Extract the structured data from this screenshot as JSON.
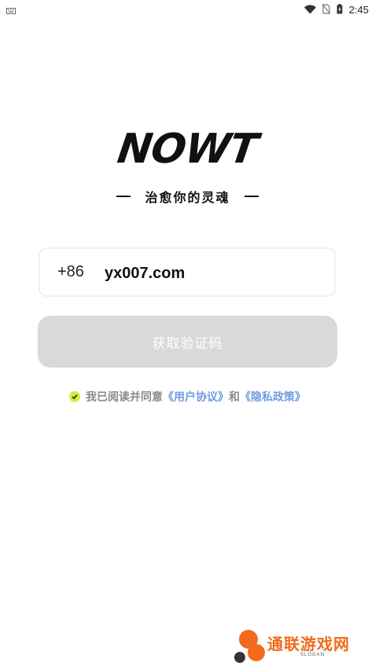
{
  "status_bar": {
    "time": "2:45",
    "icons": [
      "keyboard-icon",
      "wifi-icon",
      "no-sim-icon",
      "battery-charging-icon"
    ]
  },
  "logo": {
    "text": "NOWT",
    "slogan": "治愈你的灵魂"
  },
  "login": {
    "country_code": "+86",
    "phone_value": "yx007.com",
    "get_code_label": "获取验证码"
  },
  "agreement": {
    "checked": true,
    "prefix": "我已阅读并同意",
    "user_agreement": "《用户协议》",
    "connector": "和",
    "privacy_policy": "《隐私政策》"
  },
  "watermark": {
    "title": "通联游戏网",
    "sub": "SLOGAN"
  },
  "colors": {
    "accent_link": "#6f9ce0",
    "check": "#d8ec3a",
    "button_disabled": "#d9d9d9",
    "watermark": "#f26a1b"
  }
}
